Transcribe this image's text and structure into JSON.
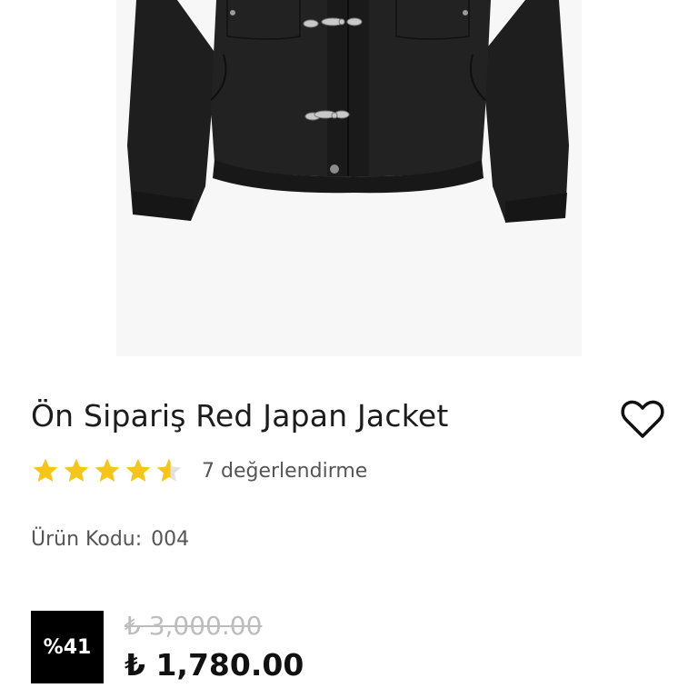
{
  "product": {
    "title": "Ön Sipariş Red Japan Jacket",
    "rating_value": 4.5,
    "rating_max": 5,
    "review_text": "7 değerlendirme",
    "code_label": "Ürün Kodu:",
    "code_value": "004",
    "discount_badge": "%41",
    "old_price": "₺ 3,000.00",
    "new_price": "₺ 1,780.00"
  },
  "icons": {
    "favorite": "heart-outline-icon",
    "star": "star-icon"
  },
  "colors": {
    "star": "#f5c518",
    "badge_bg": "#000000",
    "old_price": "#bdbdbd"
  }
}
